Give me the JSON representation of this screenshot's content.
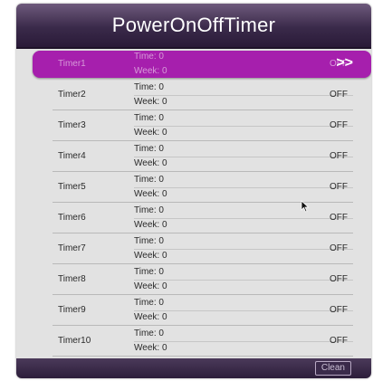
{
  "title": "PowerOnOffTimer",
  "timers": [
    {
      "name": "Timer1",
      "time": "Time: 0",
      "week": "Week: 0",
      "state": "OFF",
      "selected": true
    },
    {
      "name": "Timer2",
      "time": "Time: 0",
      "week": "Week: 0",
      "state": "OFF"
    },
    {
      "name": "Timer3",
      "time": "Time: 0",
      "week": "Week: 0",
      "state": "OFF"
    },
    {
      "name": "Timer4",
      "time": "Time: 0",
      "week": "Week: 0",
      "state": "OFF"
    },
    {
      "name": "Timer5",
      "time": "Time: 0",
      "week": "Week: 0",
      "state": "OFF"
    },
    {
      "name": "Timer6",
      "time": "Time: 0",
      "week": "Week: 0",
      "state": "OFF"
    },
    {
      "name": "Timer7",
      "time": "Time: 0",
      "week": "Week: 0",
      "state": "OFF"
    },
    {
      "name": "Timer8",
      "time": "Time: 0",
      "week": "Week: 0",
      "state": "OFF"
    },
    {
      "name": "Timer9",
      "time": "Time: 0",
      "week": "Week: 0",
      "state": "OFF"
    },
    {
      "name": "Timer10",
      "time": "Time: 0",
      "week": "Week: 0",
      "state": "OFF"
    }
  ],
  "selected_arrow_glyph": ">>",
  "bottom": {
    "clean_label": "Clean"
  },
  "colors": {
    "highlight": "#a61fad",
    "title_bar": "#3a2a4a",
    "panel_bg": "#e2e2e2"
  }
}
